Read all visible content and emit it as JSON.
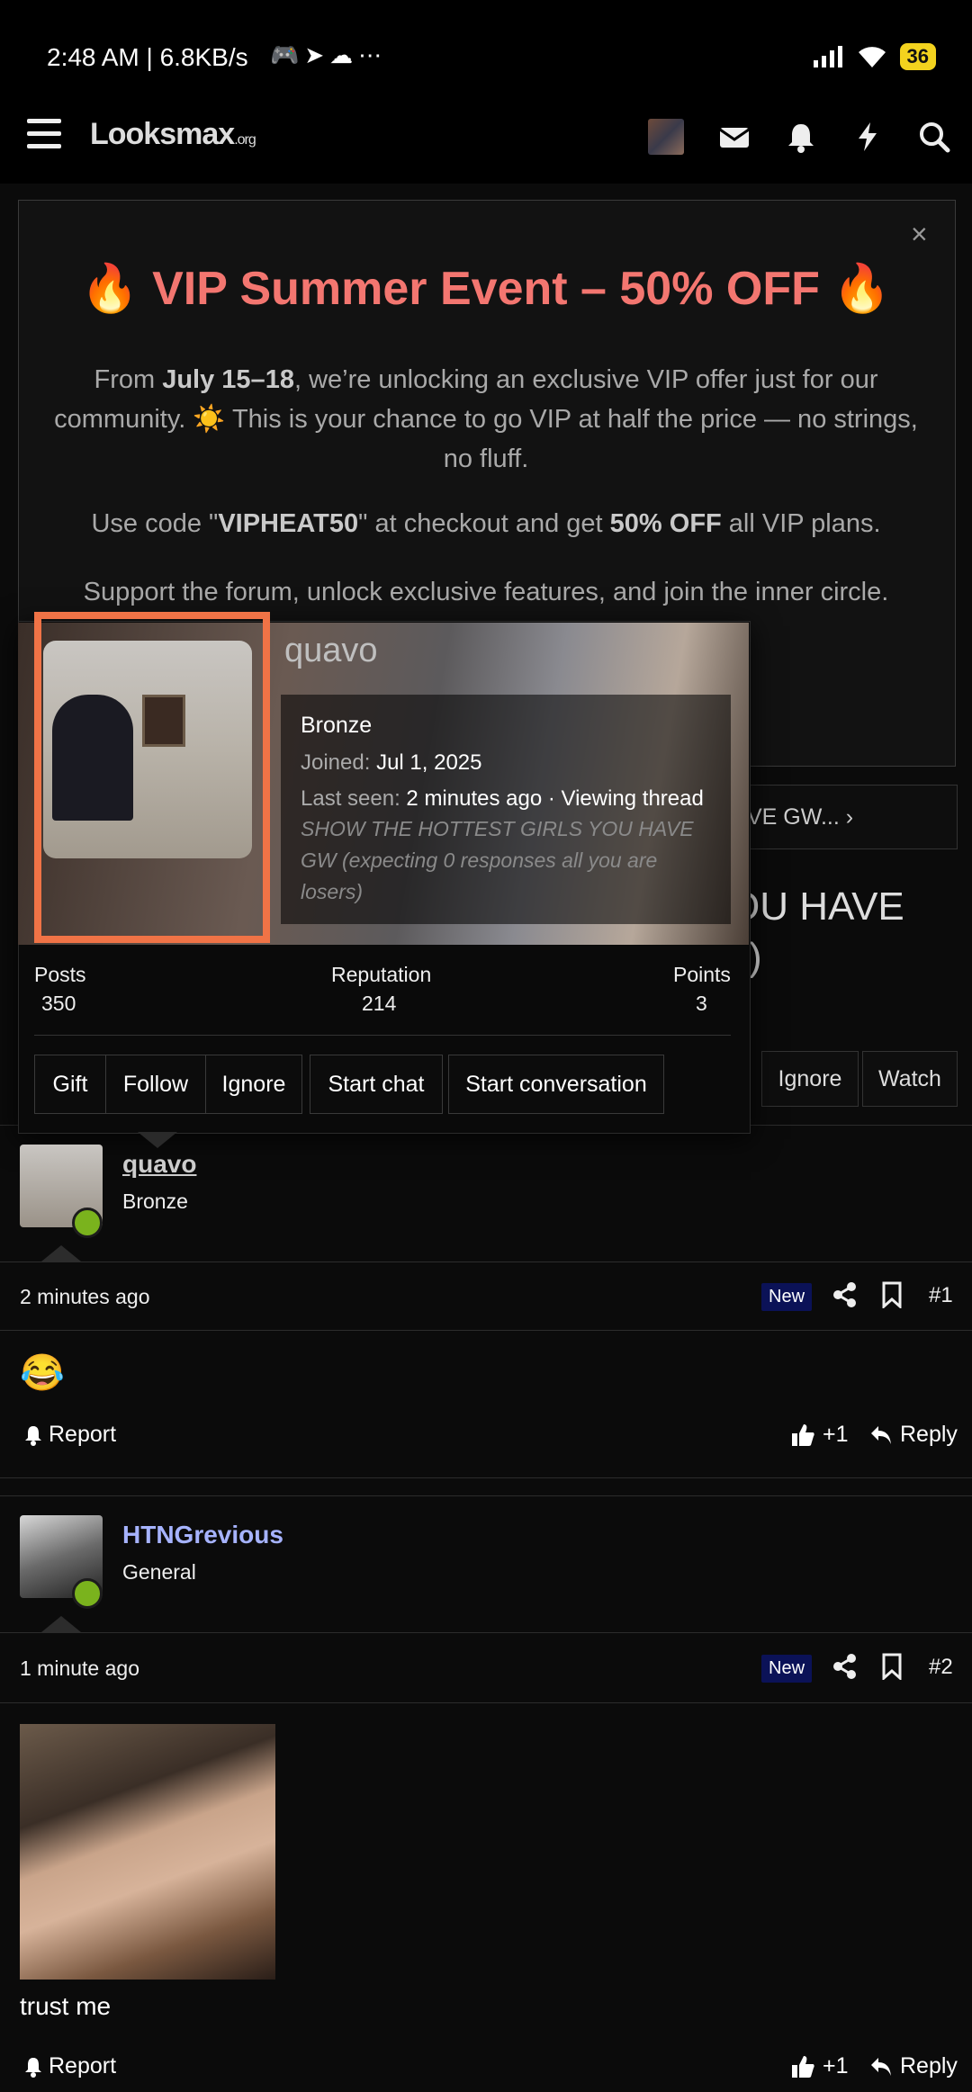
{
  "status_bar": {
    "time": "2:48 AM | 6.8KB/s",
    "extra": "⋯",
    "battery": "36"
  },
  "header": {
    "logo": "Looksmax",
    "logo_suffix": ".org"
  },
  "banner": {
    "title": "🔥 VIP Summer Event – 50% OFF 🔥",
    "close": "×",
    "p1_pre": "From ",
    "p1_bold": "July 15–18",
    "p1_post": ", we’re unlocking an exclusive VIP offer just for our community. ☀️ This is your chance to go VIP at half the price — no strings, no fluff.",
    "p2_pre": "Use code \"",
    "p2_code": "VIPHEAT50",
    "p2_mid": "\" at checkout and get ",
    "p2_bold": "50% OFF",
    "p2_post": " all VIP plans.",
    "p3": "Support the forum, unlock exclusive features, and join the inner circle."
  },
  "thread": {
    "tab_label": "VE GW...",
    "title_visible_line1": "OU HAVE",
    "title_visible_line2": "s)",
    "buttons": [
      "Ignore",
      "Watch"
    ]
  },
  "popup": {
    "username": "quavo",
    "rank": "Bronze",
    "joined_label": "Joined:",
    "joined_value": "Jul 1, 2025",
    "last_seen_label": "Last seen:",
    "last_seen_value": "2 minutes ago · Viewing thread",
    "status_text": "SHOW THE HOTTEST GIRLS YOU HAVE GW (expecting 0 responses all you are losers)",
    "stats": [
      {
        "label": "Posts",
        "value": "350"
      },
      {
        "label": "Reputation",
        "value": "214"
      },
      {
        "label": "Points",
        "value": "3"
      }
    ],
    "actions": [
      "Gift",
      "Follow",
      "Ignore",
      "Start chat",
      "Start conversation"
    ]
  },
  "posts": [
    {
      "username": "quavo",
      "role": "Bronze",
      "time": "2 minutes ago",
      "badge": "New",
      "number": "#1",
      "body": "😂",
      "report": "Report",
      "react": "+1",
      "reply": "Reply"
    },
    {
      "username": "HTNGrevious",
      "role": "General",
      "time": "1 minute ago",
      "badge": "New",
      "number": "#2",
      "body": "trust me",
      "report": "Report",
      "react": "+1",
      "reply": "Reply"
    }
  ],
  "colors": {
    "accent_red": "#f37670",
    "username_blue": "#a6b3ff",
    "online": "#7ab31d",
    "highlight": "#f07346",
    "badge": "#0b1257"
  }
}
